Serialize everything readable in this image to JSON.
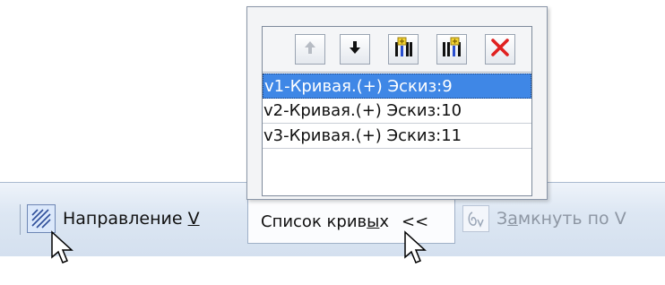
{
  "popup": {
    "toolbar": {
      "up_icon": "arrow-up-icon",
      "down_icon": "arrow-down-icon",
      "insert_before_icon": "insert-before-icon",
      "insert_after_icon": "insert-after-icon",
      "delete_icon": "delete-x-icon"
    },
    "curves": [
      {
        "label": "v1-Кривая.(+) Эскиз:9",
        "selected": true
      },
      {
        "label": "v2-Кривая.(+) Эскиз:10",
        "selected": false
      },
      {
        "label": "v3-Кривая.(+) Эскиз:11",
        "selected": false
      }
    ]
  },
  "toolbar": {
    "direction": {
      "label_prefix": "Направление ",
      "label_hotkey": "V"
    },
    "curves_list": {
      "label_pre": "Список крив",
      "label_hotkey": "ы",
      "label_post": "х",
      "arrows": "<<"
    },
    "close_v": {
      "label_pre": "З",
      "label_hotkey": "а",
      "label_post": "мкнуть по V"
    }
  },
  "colors": {
    "selection": "#3f87e6",
    "delete_red": "#e02020",
    "toolbar_bg": "#dde7f3",
    "disabled_text": "#8d96a3"
  }
}
